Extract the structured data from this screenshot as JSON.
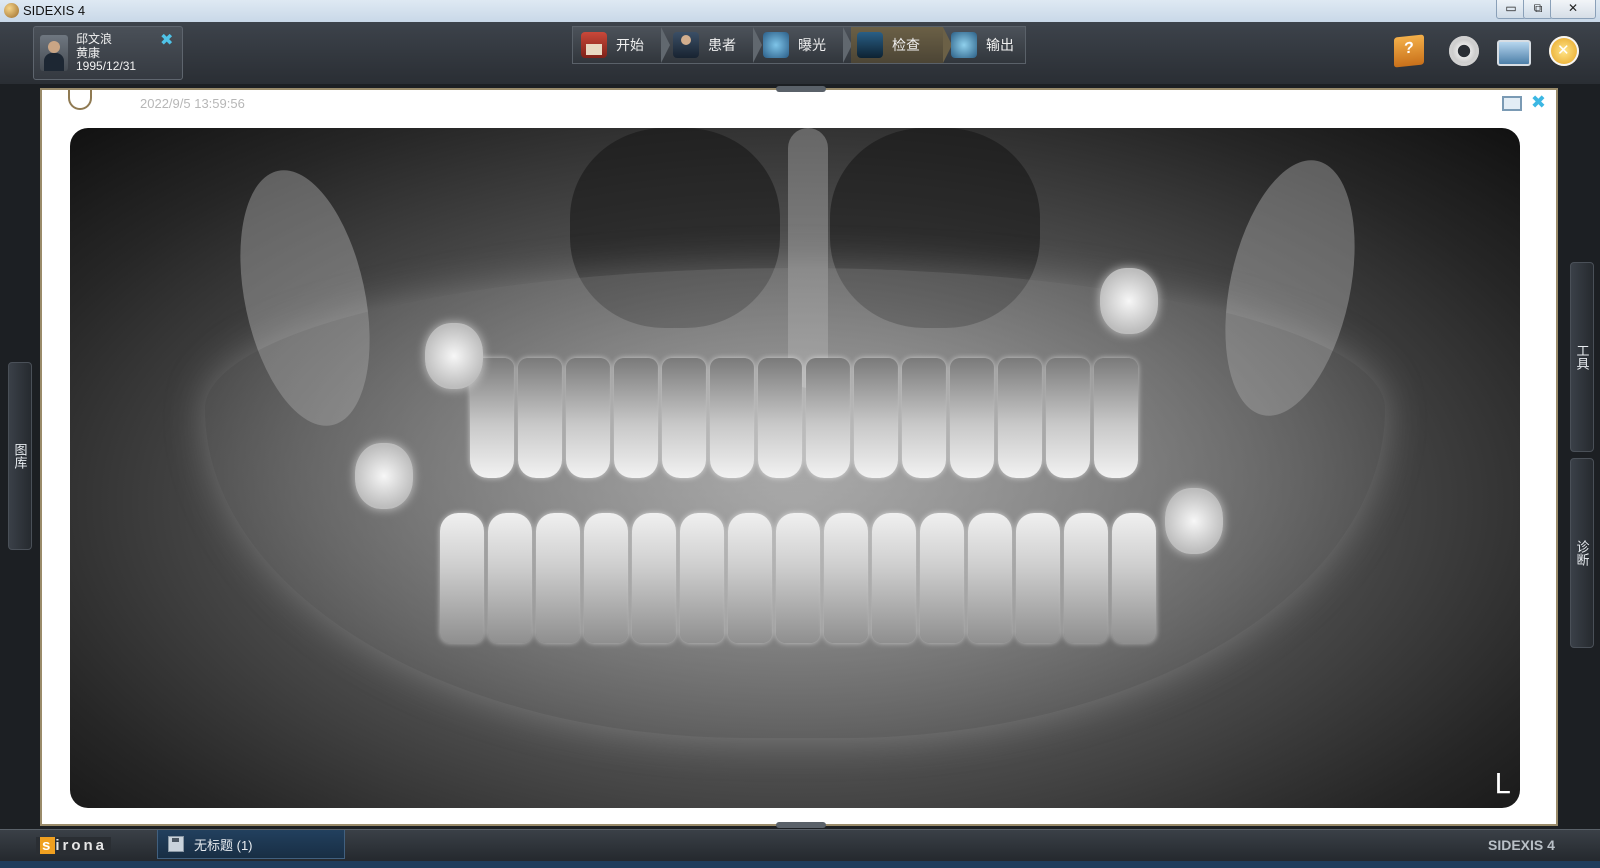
{
  "window": {
    "title": "SIDEXIS 4",
    "min": "▭",
    "max": "⧉",
    "close": "✕"
  },
  "patient": {
    "name1": "邱文浪",
    "name2": "黄康",
    "birthdate": "1995/12/31"
  },
  "nav": [
    {
      "label": "开始",
      "icon": "home-icon"
    },
    {
      "label": "患者",
      "icon": "patient-icon"
    },
    {
      "label": "曝光",
      "icon": "expose-icon"
    },
    {
      "label": "检查",
      "icon": "exam-icon",
      "active": true
    },
    {
      "label": "输出",
      "icon": "output-icon"
    }
  ],
  "side_tabs": {
    "left": "图库",
    "tools": "工具",
    "diagnosis": "诊断"
  },
  "viewer": {
    "timestamp": "2022/9/5 13:59:56",
    "orientation_label": "L"
  },
  "bottom": {
    "brand_left": "irona",
    "brand_s": "s",
    "document_tab": "无标题 (1)",
    "brand_right": "SIDEXIS 4"
  },
  "colors": {
    "accent": "#3cb7e3",
    "active_nav": "#6b6046",
    "chrome": "#2b2f35"
  }
}
